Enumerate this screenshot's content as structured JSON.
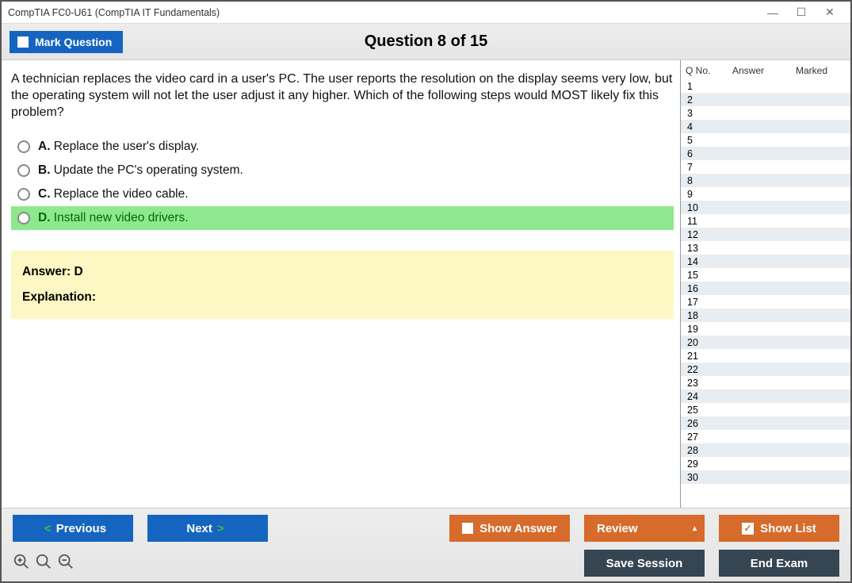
{
  "window_title": "CompTIA FC0-U61 (CompTIA IT Fundamentals)",
  "toolbar": {
    "mark_label": "Mark Question",
    "question_header": "Question 8 of 15"
  },
  "question": {
    "text": "A technician replaces the video card in a user's PC. The user reports the resolution on the display seems very low, but the operating system will not let the user adjust it any higher. Which of the following steps would MOST likely fix this problem?",
    "options": [
      {
        "letter": "A.",
        "text": "Replace the user's display.",
        "correct": false
      },
      {
        "letter": "B.",
        "text": "Update the PC's operating system.",
        "correct": false
      },
      {
        "letter": "C.",
        "text": "Replace the video cable.",
        "correct": false
      },
      {
        "letter": "D.",
        "text": "Install new video drivers.",
        "correct": true
      }
    ],
    "answer_line": "Answer: D",
    "explanation_label": "Explanation:"
  },
  "side": {
    "headers": {
      "qno": "Q No.",
      "answer": "Answer",
      "marked": "Marked"
    },
    "count": 30
  },
  "buttons": {
    "previous": "Previous",
    "next": "Next",
    "show_answer": "Show Answer",
    "review": "Review",
    "show_list": "Show List",
    "save_session": "Save Session",
    "end_exam": "End Exam"
  }
}
